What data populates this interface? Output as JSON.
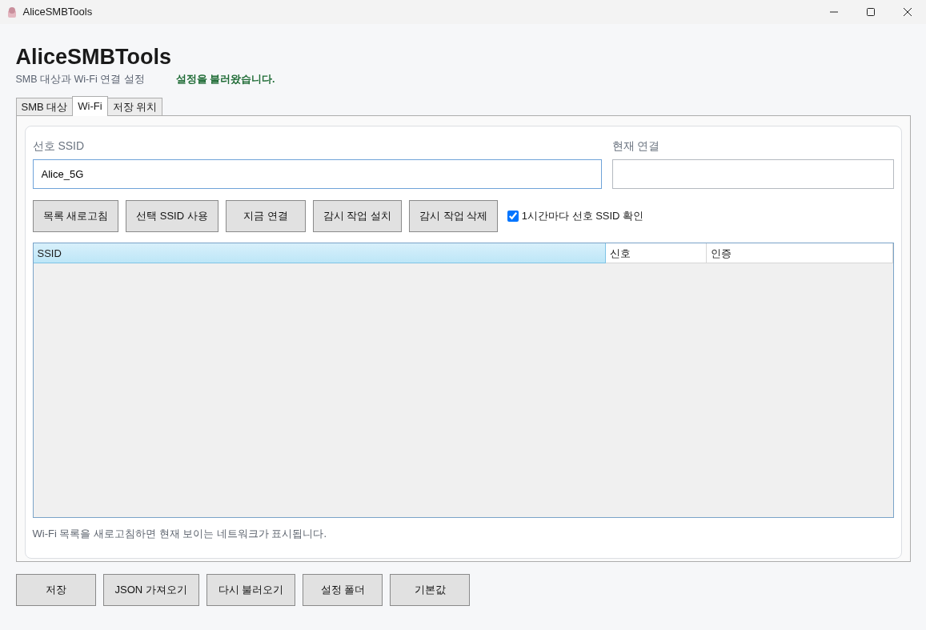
{
  "window": {
    "title": "AliceSMBTools"
  },
  "header": {
    "title": "AliceSMBTools",
    "subtitle": "SMB 대상과 Wi-Fi 연결 설정",
    "status": "설정을 불러왔습니다."
  },
  "tabs": [
    {
      "label": "SMB 대상",
      "selected": false
    },
    {
      "label": "Wi-Fi",
      "selected": true
    },
    {
      "label": "저장 위치",
      "selected": false
    }
  ],
  "wifi": {
    "preferred_ssid": {
      "label": "선호 SSID",
      "value": "Alice_5G"
    },
    "current_connection": {
      "label": "현재 연결"
    },
    "buttons": [
      "목록 새로고침",
      "선택 SSID 사용",
      "지금 연결",
      "감시 작업 설치",
      "감시 작업 삭제"
    ],
    "hourly_check": {
      "label": "1시간마다 선호 SSID 확인",
      "checked": true
    },
    "table": {
      "columns": [
        {
          "label": "SSID",
          "selected": true
        },
        {
          "label": "신호",
          "selected": false
        },
        {
          "label": "인증",
          "selected": false
        }
      ]
    },
    "hint": "Wi-Fi 목록을 새로고침하면 현재 보이는 네트워크가 표시됩니다."
  },
  "footer_buttons": [
    "저장",
    "JSON 가져오기",
    "다시 불러오기",
    "설정 폴더",
    "기본값"
  ]
}
